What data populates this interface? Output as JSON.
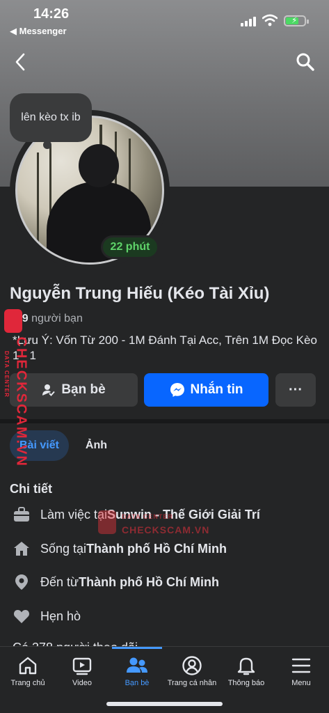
{
  "status_bar": {
    "time": "14:26",
    "back_app": "◀ Messenger"
  },
  "header": {
    "back_icon": "chevron-left-icon",
    "search_icon": "search-icon"
  },
  "profile": {
    "note_bubble": "lên kèo tx ib",
    "active_badge": "22 phút",
    "name": "Nguyễn Trung Hiếu (Kéo Tài Xỉu)",
    "friends_count": "599",
    "friends_label": "người bạn",
    "bio": "*Lưu Ý: Vốn Từ 200 - 1M Đánh Tại Acc, Trên 1M Đọc Kèo 1 - 1"
  },
  "actions": {
    "friends_button": "Bạn bè",
    "message_button": "Nhắn tin",
    "more_button": "···"
  },
  "tabs": [
    {
      "label": "Bài viết",
      "active": true
    },
    {
      "label": "Ảnh",
      "active": false
    }
  ],
  "details": {
    "title": "Chi tiết",
    "items": [
      {
        "icon": "briefcase-icon",
        "prefix": "Làm việc tại ",
        "value": "Sunwin - Thế Giới Giải Trí"
      },
      {
        "icon": "home-icon",
        "prefix": "Sống tại ",
        "value": "Thành phố Hồ Chí Minh"
      },
      {
        "icon": "location-pin-icon",
        "prefix": "Đến từ ",
        "value": "Thành phố Hồ Chí Minh"
      },
      {
        "icon": "heart-icon",
        "prefix": "Hẹn hò",
        "value": ""
      }
    ],
    "partial_row": "Có 378 người theo dõi"
  },
  "tabbar": [
    {
      "label": "Trang chủ",
      "icon": "home-icon",
      "active": false
    },
    {
      "label": "Video",
      "icon": "video-icon",
      "active": false
    },
    {
      "label": "Bạn bè",
      "icon": "friends-icon",
      "active": true
    },
    {
      "label": "Trang cá nhân",
      "icon": "profile-icon",
      "active": false
    },
    {
      "label": "Thông báo",
      "icon": "bell-icon",
      "active": false
    },
    {
      "label": "Menu",
      "icon": "menu-icon",
      "active": false
    }
  ],
  "watermark": {
    "side_text": "CHECKSCAM.VN",
    "side_small": "DATA CENTER",
    "center_small": "DATA CENTER",
    "center_text": "CHECKSCAM.VN"
  },
  "colors": {
    "background": "#242526",
    "accent": "#0866ff",
    "active_tab": "#4599ff",
    "online_green": "#5fd46a"
  }
}
